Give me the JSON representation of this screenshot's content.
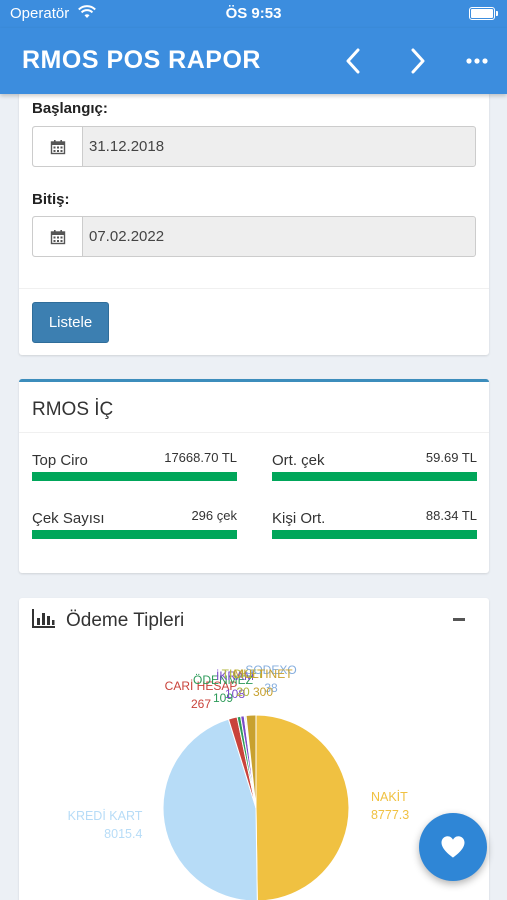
{
  "status_bar": {
    "carrier": "Operatör",
    "time": "ÖS 9:53"
  },
  "app_bar": {
    "title": "RMOS POS RAPOR"
  },
  "filter": {
    "start_label": "Başlangıç:",
    "start_value": "31.12.2018",
    "end_label": "Bitiş:",
    "end_value": "07.02.2022",
    "list_button": "Listele"
  },
  "stats": {
    "title": "RMOS İÇ",
    "items": [
      {
        "label": "Top Ciro",
        "value": "17668.70 TL",
        "fill": 1.0
      },
      {
        "label": "Ort. çek",
        "value": "59.69 TL",
        "fill": 1.0
      },
      {
        "label": "Çek Sayısı",
        "value": "296 çek",
        "fill": 1.0
      },
      {
        "label": "Kişi Ort.",
        "value": "88.34 TL",
        "fill": 1.0
      }
    ]
  },
  "payment_chart": {
    "title": "Ödeme Tipleri"
  },
  "chart_data": {
    "type": "pie",
    "slices": [
      {
        "label": "NAKİT",
        "value": 8777.3,
        "value_label": "8777.3",
        "color": "#f0c141"
      },
      {
        "label": "KREDİ KART",
        "value": 8015.4,
        "value_label": "8015.4",
        "color": "#b7dcf7"
      },
      {
        "label": "CARİ HESAP",
        "value": 267,
        "value_label": "267",
        "color": "#c9433b"
      },
      {
        "label": "ÖDENMEZ",
        "value": 109,
        "value_label": "109",
        "color": "#2e9b5a"
      },
      {
        "label": "İKRAM",
        "value": 108,
        "value_label": "108",
        "color": "#7b4bc9"
      },
      {
        "label": "TICKET",
        "value": 20,
        "value_label": "20",
        "color": "#b0b53a"
      },
      {
        "label": "SODEXO",
        "value": 38,
        "value_label": "38",
        "color": "#85aede"
      },
      {
        "label": "MULTINET",
        "value": 300,
        "value_label": "300",
        "color": "#c8a12f"
      }
    ]
  },
  "fab": {
    "icon": "heart-icon"
  }
}
